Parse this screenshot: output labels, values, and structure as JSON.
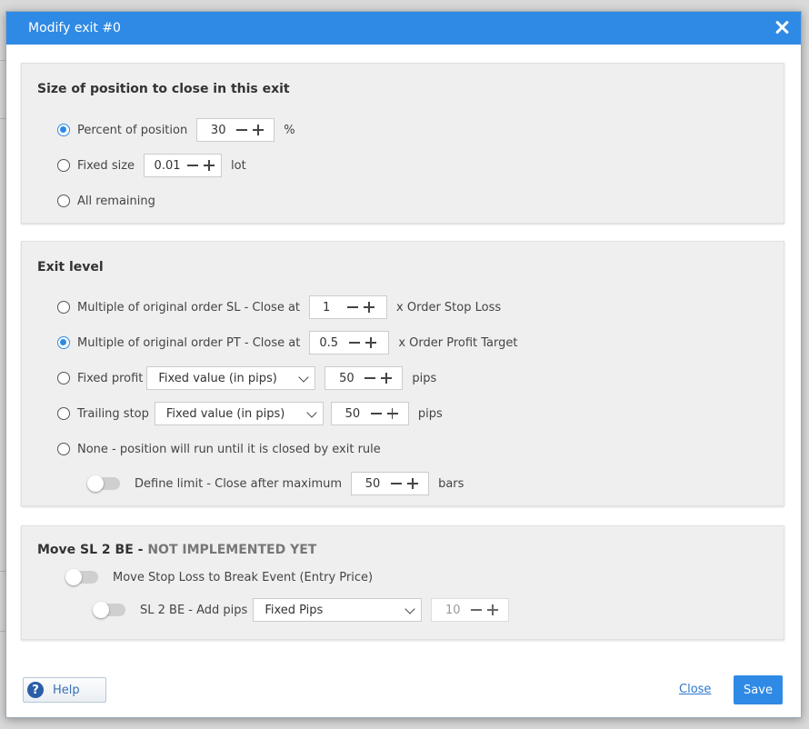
{
  "dialog": {
    "title": "Modify exit #0",
    "close_icon": "close-icon"
  },
  "size_section": {
    "title": "Size of position to close in this exit",
    "options": {
      "percent": {
        "label": "Percent of position",
        "value": "30",
        "unit": "%",
        "selected": true
      },
      "fixed": {
        "label": "Fixed size",
        "value": "0.01",
        "unit": "lot",
        "selected": false
      },
      "all": {
        "label": "All remaining",
        "selected": false
      }
    }
  },
  "exit_section": {
    "title": "Exit level",
    "options": {
      "sl_multiple": {
        "label": "Multiple of original order SL - Close at",
        "value": "1",
        "suffix": "x Order Stop Loss",
        "selected": false
      },
      "pt_multiple": {
        "label": "Multiple of original order PT - Close at",
        "value": "0.5",
        "suffix": "x Order Profit Target",
        "selected": true
      },
      "fixed_profit": {
        "label": "Fixed profit",
        "select": "Fixed value (in pips)",
        "value": "50",
        "unit": "pips",
        "selected": false
      },
      "trailing": {
        "label": "Trailing stop",
        "select": "Fixed value (in pips)",
        "value": "50",
        "unit": "pips",
        "selected": false
      },
      "none": {
        "label": "None - position will run until it is closed by exit rule",
        "selected": false
      }
    },
    "limit": {
      "label": "Define limit - Close after maximum",
      "value": "50",
      "unit": "bars",
      "enabled": false
    }
  },
  "be_section": {
    "title_main": "Move SL 2 BE - ",
    "title_warn": "NOT IMPLEMENTED YET",
    "move_sl": {
      "label": "Move Stop Loss to Break Event (Entry Price)",
      "enabled": false
    },
    "add_pips": {
      "label": "SL 2 BE - Add pips",
      "select": "Fixed Pips",
      "value": "10",
      "enabled": false
    }
  },
  "footer": {
    "help_label": "Help",
    "close_label": "Close",
    "save_label": "Save"
  },
  "colors": {
    "accent": "#2f8ae5",
    "link": "#2d77cf",
    "section_bg": "#efefef"
  }
}
